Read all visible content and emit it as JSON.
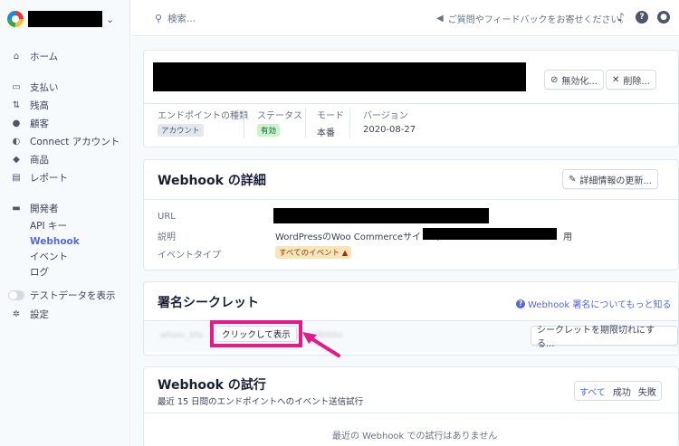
{
  "sidebar": {
    "account_chevron": "⌄",
    "items": [
      {
        "label": "ホーム",
        "icon": "home-icon"
      },
      {
        "label": "支払い",
        "icon": "payments-icon"
      },
      {
        "label": "残高",
        "icon": "balance-icon"
      },
      {
        "label": "顧客",
        "icon": "customers-icon"
      },
      {
        "label": "Connect アカウント",
        "icon": "connect-icon"
      },
      {
        "label": "商品",
        "icon": "products-icon"
      },
      {
        "label": "レポート",
        "icon": "reports-icon"
      },
      {
        "label": "開発者",
        "icon": "developers-icon"
      }
    ],
    "developer_sub": [
      "API キー",
      "Webhook",
      "イベント",
      "ログ"
    ],
    "test_data_label": "テストデータを表示",
    "settings_label": "設定"
  },
  "topbar": {
    "search_placeholder": "検索...",
    "feedback": "ご質問やフィードバックをお寄せください。"
  },
  "endpoint": {
    "disable_button": "無効化...",
    "delete_button": "削除...",
    "meta": {
      "type_label": "エンドポイントの種類",
      "type_value": "アカウント",
      "status_label": "ステータス",
      "status_value": "有効",
      "mode_label": "モード",
      "mode_value": "本番",
      "version_label": "バージョン",
      "version_value": "2020-08-27"
    }
  },
  "details": {
    "title": "Webhook の詳細",
    "update_button": "詳細情報の更新...",
    "url_label": "URL",
    "desc_label": "説明",
    "desc_value_prefix": "WordPressのWoo Commerceサイト（",
    "desc_value_suffix": "用",
    "event_type_label": "イベントタイプ",
    "event_type_value": "すべてのイベント"
  },
  "signing_secret": {
    "title": "署名シークレット",
    "learn_more": "Webhook 署名についてもっと知る",
    "masked_left": "whsec_bfa",
    "masked_right": "ckfa3kthhs",
    "reveal_button": "クリックして表示",
    "expire_button": "シークレットを期限切れにする..."
  },
  "attempts": {
    "title": "Webhook の試行",
    "subtitle": "最近 15 日間のエンドポイントへのイベント送信試行",
    "filter_all": "すべて",
    "filter_success": "成功",
    "filter_fail": "失敗",
    "empty": "最近の Webhook での試行はありません"
  },
  "colors": {
    "accent": "#5469d4",
    "highlight": "#e6198a"
  }
}
